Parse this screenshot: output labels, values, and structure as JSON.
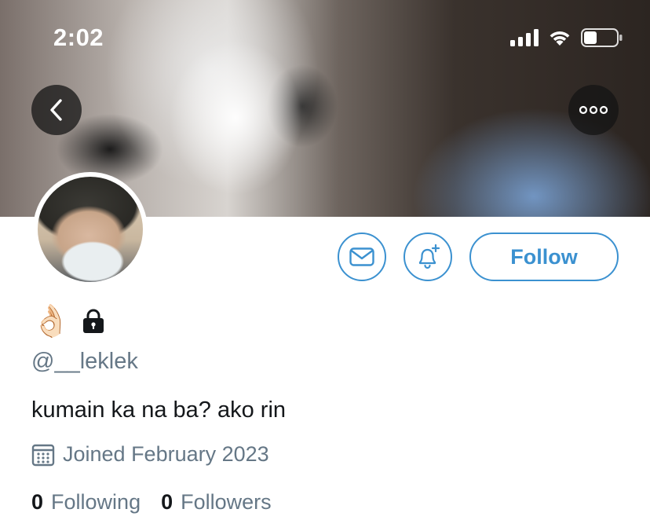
{
  "status_bar": {
    "time": "2:02"
  },
  "header": {
    "back_icon": "chevron-left-icon",
    "more_icon": "ellipsis-icon"
  },
  "profile": {
    "display_name_emoji": "👌🏻",
    "handle": "@__leklek",
    "bio": "kumain ka na ba? ako rin",
    "joined": "Joined February 2023",
    "following_count": "0",
    "following_label": "Following",
    "followers_count": "0",
    "followers_label": "Followers",
    "protected_icon": "lock-icon"
  },
  "actions": {
    "message_icon": "envelope-icon",
    "notify_icon": "bell-plus-icon",
    "follow_label": "Follow"
  },
  "colors": {
    "accent": "#3b91d0",
    "muted": "#657786",
    "text": "#14171a"
  }
}
